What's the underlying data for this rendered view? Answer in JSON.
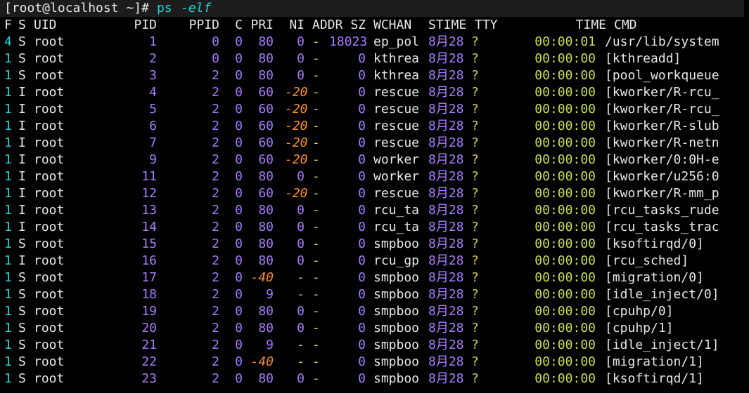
{
  "colors": {
    "background": "#000000",
    "text": "#e8e8e8",
    "command": "#23d7d7",
    "numbers": "#a77cff",
    "question": "#d8d24a",
    "nice_negative": "#ff9020",
    "time": "#c7e04a"
  },
  "prompt": {
    "user_host": "[root@localhost ~]#",
    "command": "ps",
    "args": "-elf"
  },
  "header": [
    "F",
    "S",
    "UID",
    "PID",
    "PPID",
    "C",
    "PRI",
    "NI",
    "ADDR",
    "SZ",
    "WCHAN",
    "STIME",
    "TTY",
    "TIME",
    "CMD"
  ],
  "rows": [
    {
      "f": "4",
      "s": "S",
      "uid": "root",
      "pid": "1",
      "ppid": "0",
      "c": "0",
      "pri": "80",
      "ni": "0",
      "addr": "-",
      "sz": "18023",
      "wchan": "ep_pol",
      "stime": "8月28",
      "tty": "?",
      "time": "00:00:01",
      "cmd": "/usr/lib/system"
    },
    {
      "f": "1",
      "s": "S",
      "uid": "root",
      "pid": "2",
      "ppid": "0",
      "c": "0",
      "pri": "80",
      "ni": "0",
      "addr": "-",
      "sz": "0",
      "wchan": "kthrea",
      "stime": "8月28",
      "tty": "?",
      "time": "00:00:00",
      "cmd": "[kthreadd]"
    },
    {
      "f": "1",
      "s": "S",
      "uid": "root",
      "pid": "3",
      "ppid": "2",
      "c": "0",
      "pri": "80",
      "ni": "0",
      "addr": "-",
      "sz": "0",
      "wchan": "kthrea",
      "stime": "8月28",
      "tty": "?",
      "time": "00:00:00",
      "cmd": "[pool_workqueue"
    },
    {
      "f": "1",
      "s": "I",
      "uid": "root",
      "pid": "4",
      "ppid": "2",
      "c": "0",
      "pri": "60",
      "ni": "-20",
      "addr": "-",
      "sz": "0",
      "wchan": "rescue",
      "stime": "8月28",
      "tty": "?",
      "time": "00:00:00",
      "cmd": "[kworker/R-rcu_"
    },
    {
      "f": "1",
      "s": "I",
      "uid": "root",
      "pid": "5",
      "ppid": "2",
      "c": "0",
      "pri": "60",
      "ni": "-20",
      "addr": "-",
      "sz": "0",
      "wchan": "rescue",
      "stime": "8月28",
      "tty": "?",
      "time": "00:00:00",
      "cmd": "[kworker/R-rcu_"
    },
    {
      "f": "1",
      "s": "I",
      "uid": "root",
      "pid": "6",
      "ppid": "2",
      "c": "0",
      "pri": "60",
      "ni": "-20",
      "addr": "-",
      "sz": "0",
      "wchan": "rescue",
      "stime": "8月28",
      "tty": "?",
      "time": "00:00:00",
      "cmd": "[kworker/R-slub"
    },
    {
      "f": "1",
      "s": "I",
      "uid": "root",
      "pid": "7",
      "ppid": "2",
      "c": "0",
      "pri": "60",
      "ni": "-20",
      "addr": "-",
      "sz": "0",
      "wchan": "rescue",
      "stime": "8月28",
      "tty": "?",
      "time": "00:00:00",
      "cmd": "[kworker/R-netn"
    },
    {
      "f": "1",
      "s": "I",
      "uid": "root",
      "pid": "9",
      "ppid": "2",
      "c": "0",
      "pri": "60",
      "ni": "-20",
      "addr": "-",
      "sz": "0",
      "wchan": "worker",
      "stime": "8月28",
      "tty": "?",
      "time": "00:00:00",
      "cmd": "[kworker/0:0H-e"
    },
    {
      "f": "1",
      "s": "I",
      "uid": "root",
      "pid": "11",
      "ppid": "2",
      "c": "0",
      "pri": "80",
      "ni": "0",
      "addr": "-",
      "sz": "0",
      "wchan": "worker",
      "stime": "8月28",
      "tty": "?",
      "time": "00:00:00",
      "cmd": "[kworker/u256:0"
    },
    {
      "f": "1",
      "s": "I",
      "uid": "root",
      "pid": "12",
      "ppid": "2",
      "c": "0",
      "pri": "60",
      "ni": "-20",
      "addr": "-",
      "sz": "0",
      "wchan": "rescue",
      "stime": "8月28",
      "tty": "?",
      "time": "00:00:00",
      "cmd": "[kworker/R-mm_p"
    },
    {
      "f": "1",
      "s": "I",
      "uid": "root",
      "pid": "13",
      "ppid": "2",
      "c": "0",
      "pri": "80",
      "ni": "0",
      "addr": "-",
      "sz": "0",
      "wchan": "rcu_ta",
      "stime": "8月28",
      "tty": "?",
      "time": "00:00:00",
      "cmd": "[rcu_tasks_rude"
    },
    {
      "f": "1",
      "s": "I",
      "uid": "root",
      "pid": "14",
      "ppid": "2",
      "c": "0",
      "pri": "80",
      "ni": "0",
      "addr": "-",
      "sz": "0",
      "wchan": "rcu_ta",
      "stime": "8月28",
      "tty": "?",
      "time": "00:00:00",
      "cmd": "[rcu_tasks_trac"
    },
    {
      "f": "1",
      "s": "S",
      "uid": "root",
      "pid": "15",
      "ppid": "2",
      "c": "0",
      "pri": "80",
      "ni": "0",
      "addr": "-",
      "sz": "0",
      "wchan": "smpboo",
      "stime": "8月28",
      "tty": "?",
      "time": "00:00:00",
      "cmd": "[ksoftirqd/0]"
    },
    {
      "f": "1",
      "s": "I",
      "uid": "root",
      "pid": "16",
      "ppid": "2",
      "c": "0",
      "pri": "80",
      "ni": "0",
      "addr": "-",
      "sz": "0",
      "wchan": "rcu_gp",
      "stime": "8月28",
      "tty": "?",
      "time": "00:00:00",
      "cmd": "[rcu_sched]"
    },
    {
      "f": "1",
      "s": "S",
      "uid": "root",
      "pid": "17",
      "ppid": "2",
      "c": "0",
      "pri": "-40",
      "ni": "-",
      "addr": "-",
      "sz": "0",
      "wchan": "smpboo",
      "stime": "8月28",
      "tty": "?",
      "time": "00:00:00",
      "cmd": "[migration/0]"
    },
    {
      "f": "1",
      "s": "S",
      "uid": "root",
      "pid": "18",
      "ppid": "2",
      "c": "0",
      "pri": "9",
      "ni": "-",
      "addr": "-",
      "sz": "0",
      "wchan": "smpboo",
      "stime": "8月28",
      "tty": "?",
      "time": "00:00:00",
      "cmd": "[idle_inject/0]"
    },
    {
      "f": "1",
      "s": "S",
      "uid": "root",
      "pid": "19",
      "ppid": "2",
      "c": "0",
      "pri": "80",
      "ni": "0",
      "addr": "-",
      "sz": "0",
      "wchan": "smpboo",
      "stime": "8月28",
      "tty": "?",
      "time": "00:00:00",
      "cmd": "[cpuhp/0]"
    },
    {
      "f": "1",
      "s": "S",
      "uid": "root",
      "pid": "20",
      "ppid": "2",
      "c": "0",
      "pri": "80",
      "ni": "0",
      "addr": "-",
      "sz": "0",
      "wchan": "smpboo",
      "stime": "8月28",
      "tty": "?",
      "time": "00:00:00",
      "cmd": "[cpuhp/1]"
    },
    {
      "f": "1",
      "s": "S",
      "uid": "root",
      "pid": "21",
      "ppid": "2",
      "c": "0",
      "pri": "9",
      "ni": "-",
      "addr": "-",
      "sz": "0",
      "wchan": "smpboo",
      "stime": "8月28",
      "tty": "?",
      "time": "00:00:00",
      "cmd": "[idle_inject/1]"
    },
    {
      "f": "1",
      "s": "S",
      "uid": "root",
      "pid": "22",
      "ppid": "2",
      "c": "0",
      "pri": "-40",
      "ni": "-",
      "addr": "-",
      "sz": "0",
      "wchan": "smpboo",
      "stime": "8月28",
      "tty": "?",
      "time": "00:00:00",
      "cmd": "[migration/1]"
    },
    {
      "f": "1",
      "s": "S",
      "uid": "root",
      "pid": "23",
      "ppid": "2",
      "c": "0",
      "pri": "80",
      "ni": "0",
      "addr": "-",
      "sz": "0",
      "wchan": "smpboo",
      "stime": "8月28",
      "tty": "?",
      "time": "00:00:00",
      "cmd": "[ksoftirqd/1]"
    }
  ]
}
